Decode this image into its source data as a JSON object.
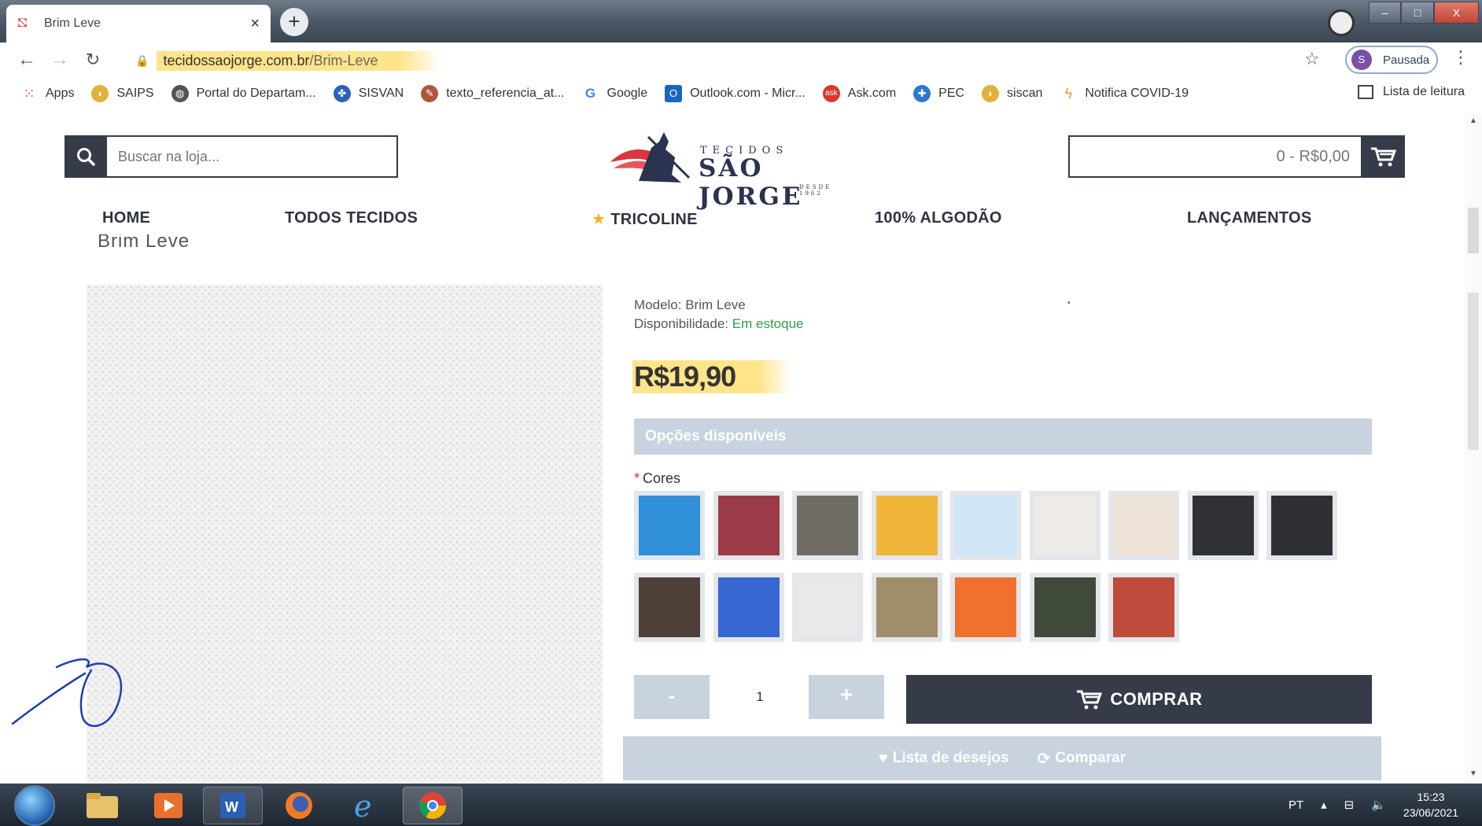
{
  "browser": {
    "tab_title": "Brim Leve",
    "tab_close": "×",
    "new_tab": "+",
    "url_domain": "tecidossaojorge.com.br",
    "url_path": "/Brim-Leve",
    "profile_initial": "S",
    "profile_status": "Pausada",
    "window_controls": [
      "–",
      "□",
      "X"
    ],
    "bookmarks": [
      {
        "label": "Apps",
        "icon": "apps-grid-icon",
        "color": "#e24a3b"
      },
      {
        "label": "SAIPS",
        "icon": "saips-icon",
        "color": "#e0b13b"
      },
      {
        "label": "Portal do Departam...",
        "icon": "globe-icon",
        "color": "#555555"
      },
      {
        "label": "SISVAN",
        "icon": "sisvan-icon",
        "color": "#2a62b8"
      },
      {
        "label": "texto_referencia_at...",
        "icon": "document-icon",
        "color": "#b0563a"
      },
      {
        "label": "Google",
        "icon": "google-icon",
        "color": "#4285f4"
      },
      {
        "label": "Outlook.com - Micr...",
        "icon": "outlook-icon",
        "color": "#1a66c2"
      },
      {
        "label": "Ask.com",
        "icon": "ask-icon",
        "color": "#d9382e"
      },
      {
        "label": "PEC",
        "icon": "pec-icon",
        "color": "#2b79d0"
      },
      {
        "label": "siscan",
        "icon": "siscan-icon",
        "color": "#e0b13b"
      },
      {
        "label": "Notifica COVID-19",
        "icon": "notifica-icon",
        "color": "#e8a11f"
      }
    ],
    "reading_list": "Lista de leitura"
  },
  "store": {
    "search_placeholder": "Buscar na loja...",
    "logo_small": "TECIDOS",
    "logo_big": "SÃO JORGE",
    "logo_since": "DESDE 1962",
    "cart_total": "0 - R$0,00",
    "nav": [
      {
        "label": "HOME"
      },
      {
        "label": "TODOS TECIDOS"
      },
      {
        "label": "TRICOLINE",
        "icon": "star-icon"
      },
      {
        "label": "100% ALGODÃO"
      },
      {
        "label": "LANÇAMENTOS"
      }
    ],
    "breadcrumb": "Brim Leve"
  },
  "product": {
    "model_label": "Modelo:",
    "model_value": "Brim Leve",
    "availability_label": "Disponibilidade:",
    "availability_value": "Em estoque",
    "price": "R$19,90",
    "options_heading": "Opções disponíveis",
    "colors_label": "Cores",
    "colors": [
      "#2f8fd8",
      "#9c3b48",
      "#6f6c66",
      "#f1b53a",
      "#cfe6f7",
      "#eeeae5",
      "#ede3d6",
      "#2f3136",
      "#2e3033",
      "#4e3f38",
      "#3666d0",
      "#e9e9e9",
      "#a08e6a",
      "#f0702e",
      "#3f4a3a",
      "#be4b3c"
    ],
    "qty_minus": "-",
    "qty_value": "1",
    "qty_plus": "+",
    "buy_label": "COMPRAR",
    "wishlist_label": "Lista de desejos",
    "compare_label": "Comparar"
  },
  "taskbar": {
    "language": "PT",
    "time": "15:23",
    "date": "23/06/2021"
  }
}
